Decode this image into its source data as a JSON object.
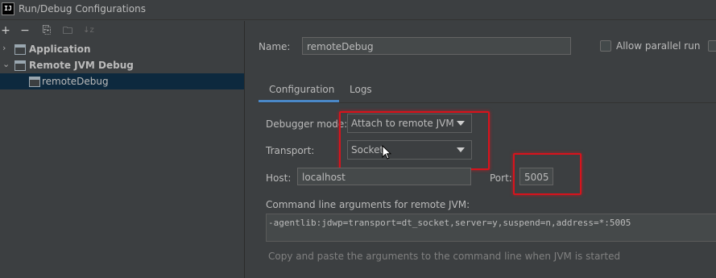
{
  "window": {
    "app_icon": "IJ",
    "title": "Run/Debug Configurations"
  },
  "toolbar": {
    "add": "+",
    "remove": "−",
    "copy": "⎘",
    "folder": "🗀",
    "sort": "↓z"
  },
  "tree": {
    "items": [
      {
        "chevron": "›",
        "label": "Application"
      },
      {
        "chevron": "⌄",
        "label": "Remote JVM Debug"
      },
      {
        "label": "remoteDebug"
      }
    ]
  },
  "form": {
    "name_label": "Name:",
    "name_value": "remoteDebug",
    "allow_parallel_label": "Allow parallel run"
  },
  "tabs": [
    {
      "label": "Configuration",
      "selected": true
    },
    {
      "label": "Logs",
      "selected": false
    }
  ],
  "config": {
    "debugger_mode_label": "Debugger mode:",
    "debugger_mode_value": "Attach to remote JVM",
    "transport_label": "Transport:",
    "transport_value": "Socket",
    "host_label": "Host:",
    "host_value": "localhost",
    "port_label": "Port:",
    "port_value": "5005",
    "cmd_label": "Command line arguments for remote JVM:",
    "cmd_value": "-agentlib:jdwp=transport=dt_socket,server=y,suspend=n,address=*:5005",
    "hint": "Copy and paste the arguments to the command line when JVM is started"
  },
  "colors": {
    "background": "#3c3f41",
    "selection": "#0d293e",
    "accent": "#4a88c7",
    "highlight": "#d8131c"
  }
}
